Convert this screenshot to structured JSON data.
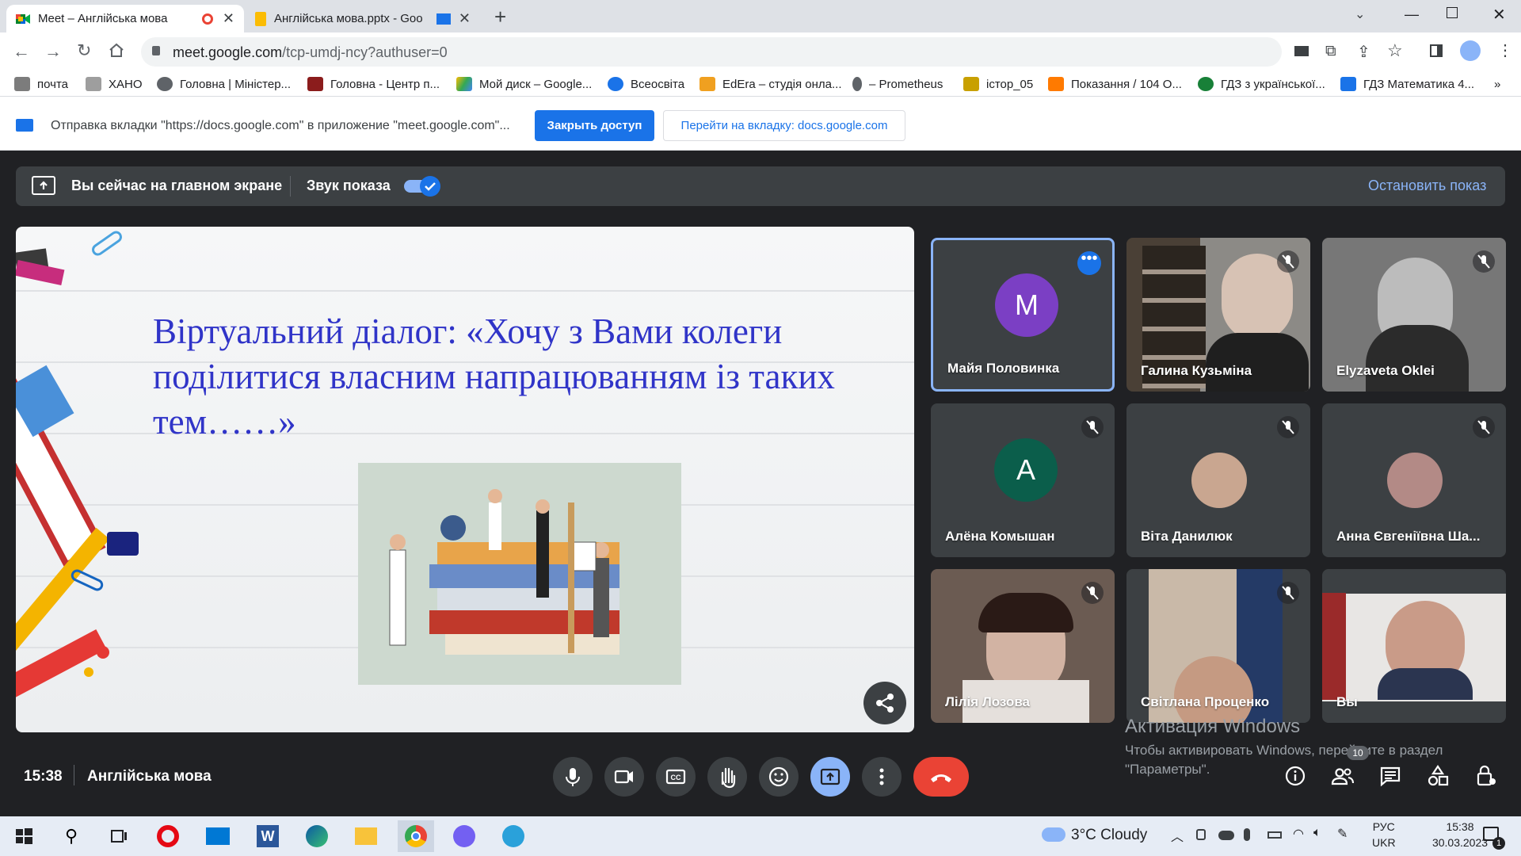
{
  "browser": {
    "tabs": [
      {
        "title": "Meet – Англійська мова",
        "active": true,
        "icon": "google-meet-icon"
      },
      {
        "title": "Англійська мова.pptx - Goo",
        "active": false,
        "icon": "google-slides-icon"
      }
    ],
    "new_tab_label": "+",
    "url_host": "meet.google.com",
    "url_path": "/tcp-umdj-ncy?authuser=0",
    "bookmarks": [
      {
        "label": "почта",
        "icon_color": "#7c7c7c"
      },
      {
        "label": "ХАНО",
        "icon_color": "#9e9e9e"
      },
      {
        "label": "Головна | Міністер...",
        "icon_color": "#5f6368"
      },
      {
        "label": "Головна - Центр п...",
        "icon_color": "#8b1c1c"
      },
      {
        "label": "Мой диск – Google...",
        "icon_color": "#fbbc04"
      },
      {
        "label": "Всеосвіта",
        "icon_color": "#1a73e8"
      },
      {
        "label": "EdEra – студія онла...",
        "icon_color": "#f0a020"
      },
      {
        "label": "– Prometheus",
        "icon_color": "#5f6368"
      },
      {
        "label": "істор_05",
        "icon_color": "#c8a000"
      },
      {
        "label": "Показання / 104 О...",
        "icon_color": "#ff7a00"
      },
      {
        "label": "ГДЗ з української...",
        "icon_color": "#188038"
      },
      {
        "label": "ГДЗ Математика 4...",
        "icon_color": "#1a73e8"
      }
    ],
    "bookmarks_more": "»"
  },
  "infobar": {
    "text": "Отправка вкладки \"https://docs.google.com\" в приложение \"meet.google.com\"...",
    "stop_label": "Закрыть доступ",
    "goto_label": "Перейти на вкладку: docs.google.com"
  },
  "presentation": {
    "main_screen_text": "Вы сейчас на главном экране",
    "sound_label": "Звук показа",
    "sound_on": true,
    "stop_label": "Остановить показ"
  },
  "slide": {
    "title": "Віртуальний діалог: «Хочу з Вами колеги поділитися власним напрацюванням із таких тем……»"
  },
  "participants": [
    {
      "name": "Майя Половинка",
      "initial": "M",
      "avatar_color": "#7b3fc4",
      "type": "avatar",
      "muted": false,
      "active": true
    },
    {
      "name": "Галина Кузьміна",
      "type": "video",
      "muted": true
    },
    {
      "name": "Elyzaveta Oklei",
      "type": "video",
      "muted": true
    },
    {
      "name": "Алёна Комышан",
      "initial": "A",
      "avatar_color": "#0b5e4b",
      "type": "avatar",
      "muted": true
    },
    {
      "name": "Віта Данилюк",
      "type": "photo",
      "muted": true
    },
    {
      "name": "Анна Євгеніївна Ша...",
      "type": "photo",
      "muted": true
    },
    {
      "name": "Лілія Лозова",
      "type": "video",
      "muted": true
    },
    {
      "name": "Світлана Проценко",
      "type": "video",
      "muted": true
    },
    {
      "name": "Вы",
      "type": "video",
      "muted": false
    }
  ],
  "meeting": {
    "time": "15:38",
    "title": "Англійська мова",
    "people_count": "10"
  },
  "watermark": {
    "line1": "Активация Windows",
    "line2": "Чтобы активировать Windows, перейдите в раздел",
    "line3": "\"Параметры\"."
  },
  "taskbar": {
    "weather": "3°C  Cloudy",
    "lang1": "РУС",
    "lang2": "UKR",
    "clock_time": "15:38",
    "clock_date": "30.03.2023",
    "notif_count": "1"
  },
  "colors": {
    "accent": "#1a73e8",
    "end_call": "#ea4335",
    "link": "#8ab4f8"
  }
}
